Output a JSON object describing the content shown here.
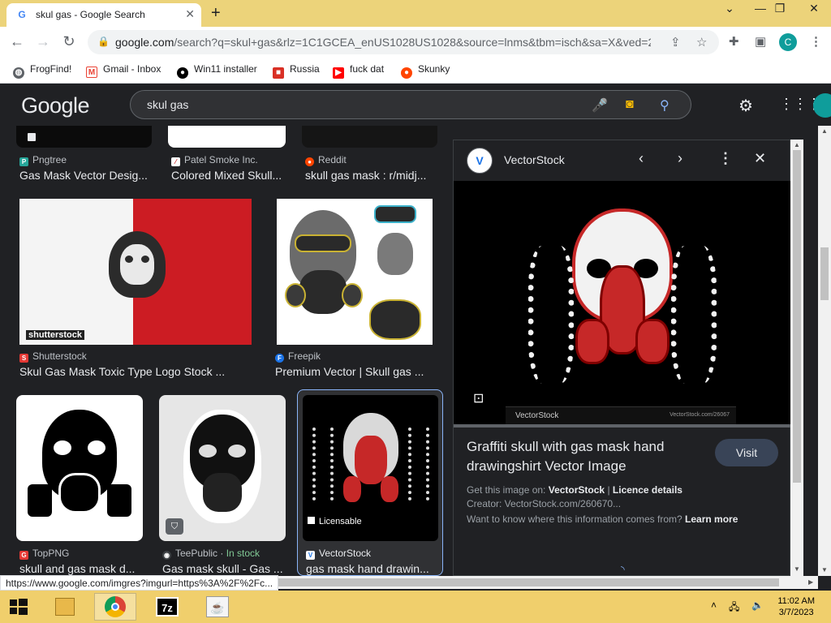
{
  "browser": {
    "tab_title": "skul gas - Google Search",
    "new_tab": "+",
    "url_host": "google.com",
    "url_rest": "/search?q=skul+gas&rlz=1C1GCEA_enUS1028US1028&source=lnms&tbm=isch&sa=X&ved=2...",
    "profile_initial": "C",
    "bookmarks": [
      "FrogFind!",
      "Gmail - Inbox",
      "Win11 installer",
      "Russia",
      "fuck dat",
      "Skunky"
    ]
  },
  "google": {
    "logo": "Google",
    "query": "skul gas"
  },
  "results": [
    {
      "source": "Pngtree",
      "caption": "Gas Mask Vector Desig..."
    },
    {
      "source": "Patel Smoke Inc.",
      "caption": "Colored Mixed Skull..."
    },
    {
      "source": "Reddit",
      "caption": "skull gas mask : r/midj..."
    },
    {
      "source": "Shutterstock",
      "caption": "Skul Gas Mask Toxic Type Logo Stock ..."
    },
    {
      "source": "Freepik",
      "caption": "Premium Vector | Skull gas ..."
    },
    {
      "source": "TopPNG",
      "caption": "skull and gas mask d..."
    },
    {
      "source": "TeePublic",
      "source_suffix": "In stock",
      "source_sep": " · ",
      "caption": "Gas mask skull - Gas ..."
    },
    {
      "source": "VectorStock",
      "caption": "gas mask hand drawin...",
      "badge": "Licensable"
    }
  ],
  "panel": {
    "source": "VectorStock",
    "title": "Graffiti skull with gas mask hand drawingshirt Vector Image",
    "visit": "Visit",
    "get_label": "Get this image on:",
    "get_source": "VectorStock",
    "licence": "Licence details",
    "creator": "Creator: VectorStock.com/260670...",
    "info_q": "Want to know where this information comes from?",
    "learn_more": "Learn more",
    "watermark": "VectorStock",
    "watermark_right": "VectorStock.com/26067"
  },
  "shutterstock_wm": "shutterstock",
  "status_url": "https://www.google.com/imgres?imgurl=https%3A%2F%2Fc...",
  "taskbar": {
    "time": "11:02 AM",
    "date": "3/7/2023"
  }
}
